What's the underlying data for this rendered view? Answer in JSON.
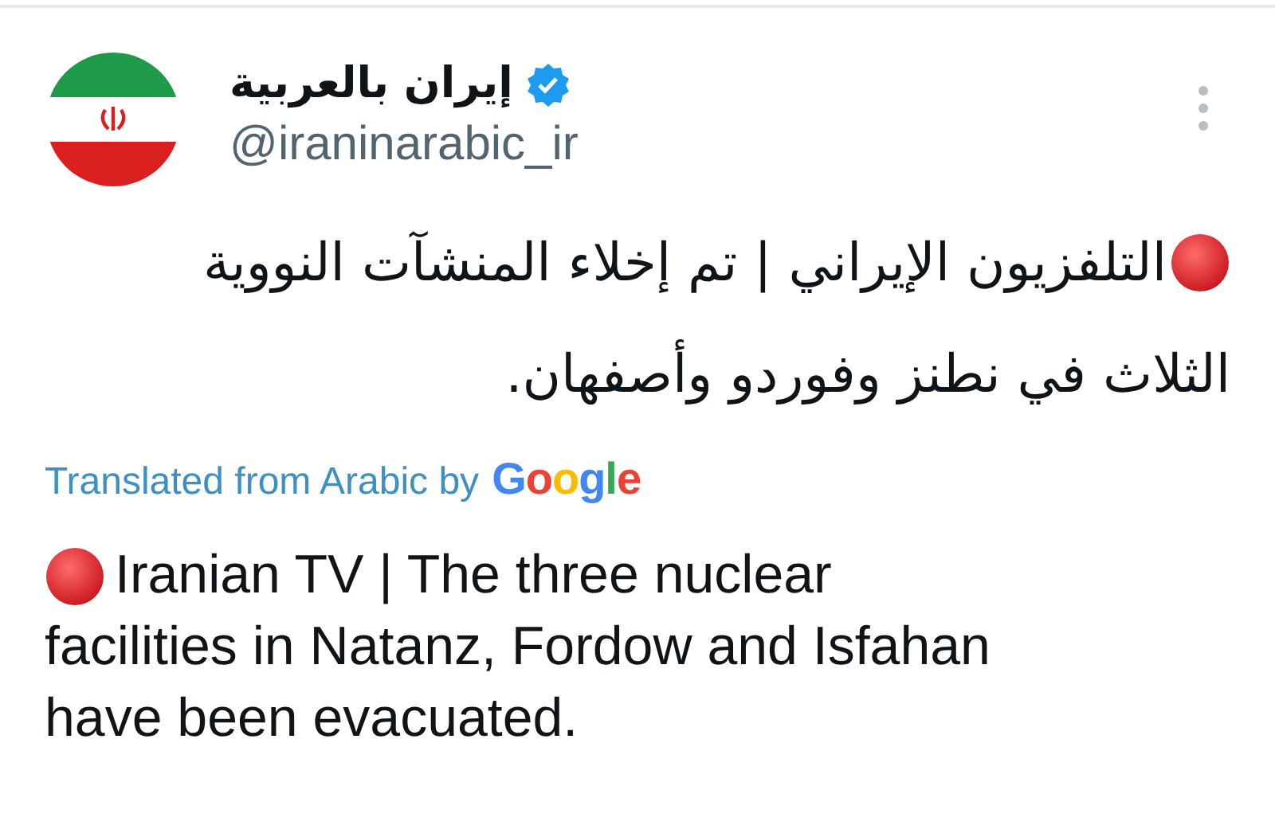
{
  "author": {
    "name": "إيران بالعربية",
    "verified": true,
    "handle": "@iraninarabic_ir"
  },
  "original_lines": [
    "التلفزيون الإيراني | تم إخلاء المنشآت النووية",
    "الثلاث في نطنز وفوردو وأصفهان."
  ],
  "translation_note": {
    "label": "Translated from Arabic by",
    "provider": "Google"
  },
  "translated_lines": [
    "Iranian TV | The three nuclear",
    "facilities in Natanz, Fordow and Isfahan",
    "have been evacuated."
  ]
}
